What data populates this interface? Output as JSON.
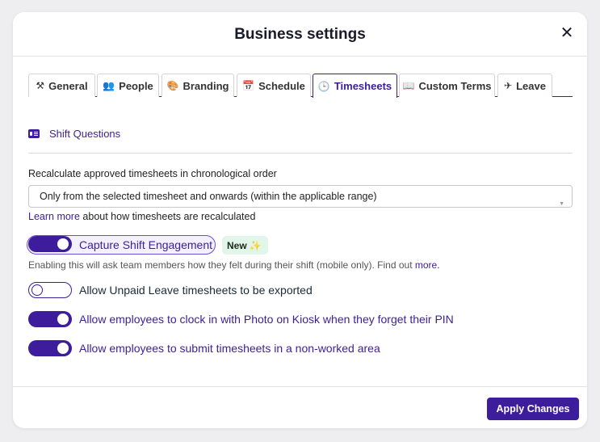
{
  "modal": {
    "title": "Business settings",
    "close_symbol": "✕"
  },
  "tabs": [
    {
      "label": "General",
      "icon": "⚒",
      "icon_name": "tools-icon",
      "active": false
    },
    {
      "label": "People",
      "icon": "👥",
      "icon_name": "people-icon",
      "active": false
    },
    {
      "label": "Branding",
      "icon": "🎨",
      "icon_name": "palette-icon",
      "active": false
    },
    {
      "label": "Schedule",
      "icon": "📅",
      "icon_name": "calendar-icon",
      "active": false
    },
    {
      "label": "Timesheets",
      "icon": "🕒",
      "icon_name": "clock-icon",
      "active": true
    },
    {
      "label": "Custom Terms",
      "icon": "📖",
      "icon_name": "book-icon",
      "active": false
    },
    {
      "label": "Leave",
      "icon": "✈",
      "icon_name": "plane-icon",
      "active": false
    }
  ],
  "shift_questions": {
    "label": "Shift Questions",
    "icon_name": "id-card-icon"
  },
  "recalc": {
    "label": "Recalculate approved timesheets in chronological order",
    "selected": "Only from the selected timesheet and onwards (within the applicable range)",
    "learn_link": "Learn more",
    "learn_rest": " about how timesheets are recalculated"
  },
  "settings": {
    "capture_engagement": {
      "label": "Capture Shift Engagement",
      "enabled": true,
      "badge": "New",
      "badge_icon": "✨",
      "description": "Enabling this will ask team members how they felt during their shift (mobile only). Find out ",
      "description_link": "more."
    },
    "unpaid_leave": {
      "label": "Allow Unpaid Leave timesheets to be exported",
      "enabled": false
    },
    "photo_kiosk": {
      "label": "Allow employees to clock in with Photo on Kiosk when they forget their PIN",
      "enabled": true
    },
    "non_worked_area": {
      "label": "Allow employees to submit timesheets in a non-worked area",
      "enabled": true
    }
  },
  "footer": {
    "apply_label": "Apply Changes"
  },
  "colors": {
    "accent": "#3d1d9c",
    "badge_bg": "#e2f5e9"
  }
}
